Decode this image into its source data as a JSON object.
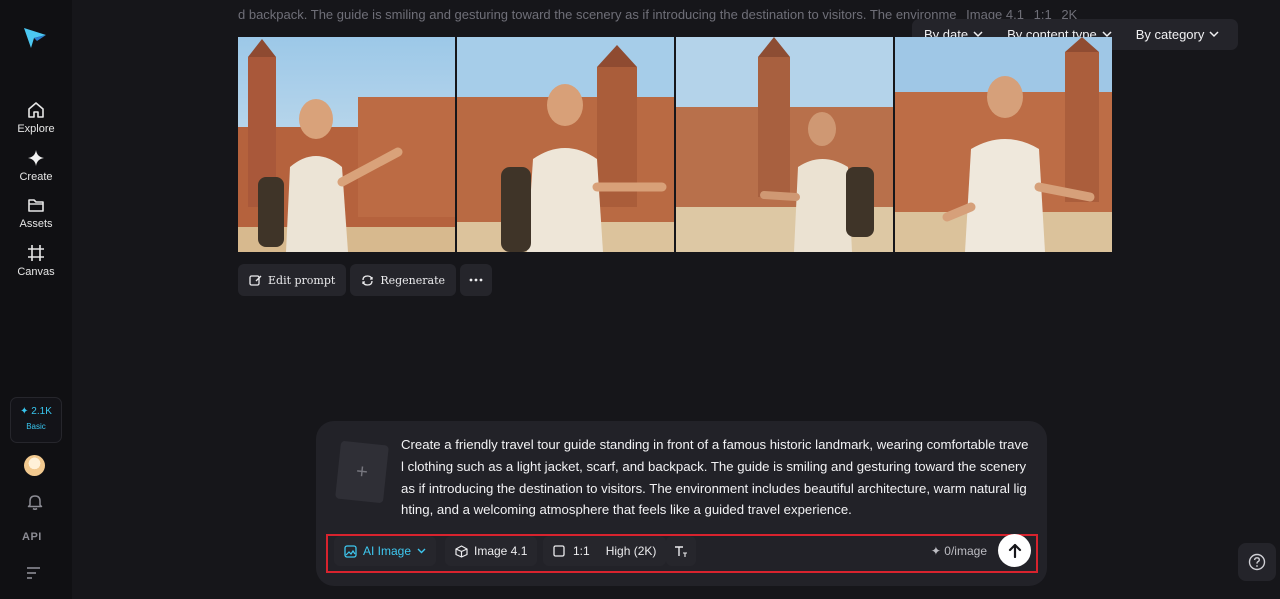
{
  "sidebar": {
    "items": [
      {
        "label": "Explore",
        "icon": "home-icon"
      },
      {
        "label": "Create",
        "icon": "sparkle-icon"
      },
      {
        "label": "Assets",
        "icon": "folder-icon"
      },
      {
        "label": "Canvas",
        "icon": "canvas-icon"
      }
    ],
    "credits": {
      "amount": "2.1K",
      "plan": "Basic"
    },
    "api_label": "API"
  },
  "caption": {
    "text": "d backpack. The guide is smiling and gesturing toward the scenery as if introducing the destination to visitors. The environme",
    "model": "Image 4.1",
    "ratio": "1:1",
    "res": "2K"
  },
  "filters": [
    {
      "label": "By date"
    },
    {
      "label": "By content type"
    },
    {
      "label": "By category"
    }
  ],
  "actions": {
    "edit_prompt": "Edit prompt",
    "regenerate": "Regenerate"
  },
  "composer": {
    "upload_symbol": "+",
    "prompt": "Create a friendly travel tour guide standing in front of a famous historic landmark, wearing comfortable travel clothing such as a light jacket, scarf, and backpack. The guide is smiling and gesturing toward the scenery as if introducing the destination to visitors. The environment includes beautiful architecture, warm natural lighting, and a welcoming atmosphere that feels like a guided travel experience.",
    "mode": "AI Image",
    "model": "Image 4.1",
    "ratio": "1:1",
    "quality": "High (2K)",
    "cost": "0/image"
  },
  "colors": {
    "accent": "#3ec8f0",
    "highlight_frame": "#d8232e",
    "background": "#16161a"
  }
}
